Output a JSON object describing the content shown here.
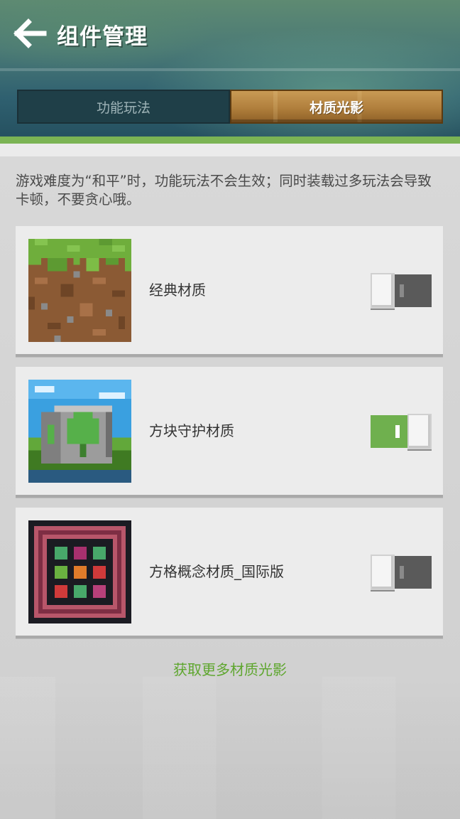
{
  "header": {
    "title": "组件管理",
    "back_icon": "arrow-left-icon"
  },
  "tabs": [
    {
      "label": "功能玩法",
      "selected": false
    },
    {
      "label": "材质光影",
      "selected": true
    }
  ],
  "notice": "游戏难度为“和平”时，功能玩法不会生效；同时装载过多玩法会导致卡顿，不要贪心哦。",
  "items": [
    {
      "name": "经典材质",
      "enabled": false,
      "thumb_icon": "grass-block-icon"
    },
    {
      "name": "方块守护材质",
      "enabled": true,
      "thumb_icon": "guardian-block-icon"
    },
    {
      "name": "方格概念材质_国际版",
      "enabled": false,
      "thumb_icon": "grid-concept-icon"
    }
  ],
  "more_link": "获取更多材质光影",
  "colors": {
    "accent_green": "#6fb04e",
    "link_green": "#5ea62e",
    "tab_selected": "#b07f3c",
    "toggle_off": "#5a5a5a"
  }
}
